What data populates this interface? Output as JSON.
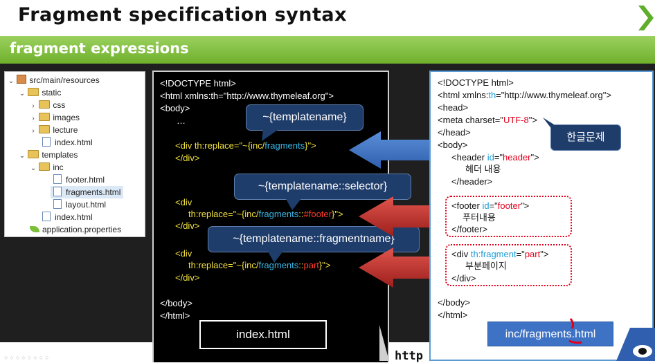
{
  "header": {
    "title": "Fragment specification syntax",
    "subtitle": "fragment expressions"
  },
  "tree": {
    "root": "src/main/resources",
    "items": [
      {
        "label": "static"
      },
      {
        "label": "css"
      },
      {
        "label": "images"
      },
      {
        "label": "lecture"
      },
      {
        "label": "index.html"
      },
      {
        "label": "templates"
      },
      {
        "label": "inc"
      },
      {
        "label": "footer.html"
      },
      {
        "label": "fragments.html"
      },
      {
        "label": "layout.html"
      },
      {
        "label": "index.html"
      },
      {
        "label": "application.properties"
      }
    ]
  },
  "index_code": {
    "l1": "<!DOCTYPE html>",
    "l2": "<html xmlns:th=\"http://www.thymeleaf.org\">",
    "l3": "<body>",
    "l4": "…",
    "l5a": "<div th:replace=\"~{inc/",
    "l5b": "fragments",
    "l5c": "}\">",
    "l6": "</div>",
    "l7": "<div",
    "l8a": "th:replace=\"~{inc/",
    "l8b": "fragments",
    "l8c": "::",
    "l8d": "#footer",
    "l8e": "}\">",
    "l9": "</div>",
    "l10": "<div",
    "l11a": "th:replace=\"~{inc/",
    "l11b": "fragments",
    "l11c": "::",
    "l11d": "part",
    "l11e": "}\">",
    "l12": "</div>",
    "l13": "</body>",
    "l14": "</html>",
    "label": "index.html"
  },
  "callouts": {
    "c1": "~{templatename}",
    "c2": "~{templatename::selector}",
    "c3": "~{templatename::fragmentname}"
  },
  "fragments_code": {
    "l1": "<!DOCTYPE html>",
    "l2a": "<html xmlns:",
    "l2b": "th",
    "l2c": "=\"http://www.thymeleaf.org\">",
    "l3": "<head>",
    "l4a": "<meta charset=\"",
    "l4b": "UTF-8",
    "l4c": "\">",
    "l5": "</head>",
    "l6": "<body>",
    "l7a": "<header ",
    "l7b": "id",
    "l7c": "=\"",
    "l7d": "header",
    "l7e": "\">",
    "l8": "헤더 내용",
    "l9": "</header>",
    "l10a": "<footer ",
    "l10b": "id",
    "l10c": "=\"",
    "l10d": "footer",
    "l10e": "\">",
    "l11": "푸터내용",
    "l12": "</footer>",
    "l13a": "<div ",
    "l13b": "th:fragment",
    "l13c": "=\"",
    "l13d": "part",
    "l13e": "\">",
    "l14": "부분페이지",
    "l15": "</div>",
    "l16": "</body>",
    "l17": "</html>",
    "label": "inc/fragments.html",
    "tag": "한글문제"
  },
  "footer": {
    "http": "http"
  },
  "colors": {
    "green_bar": "#7cbf3a",
    "arrow_blue": "#3f78c8",
    "arrow_red": "#c8322d",
    "callout_bg": "#1f3d6b"
  }
}
